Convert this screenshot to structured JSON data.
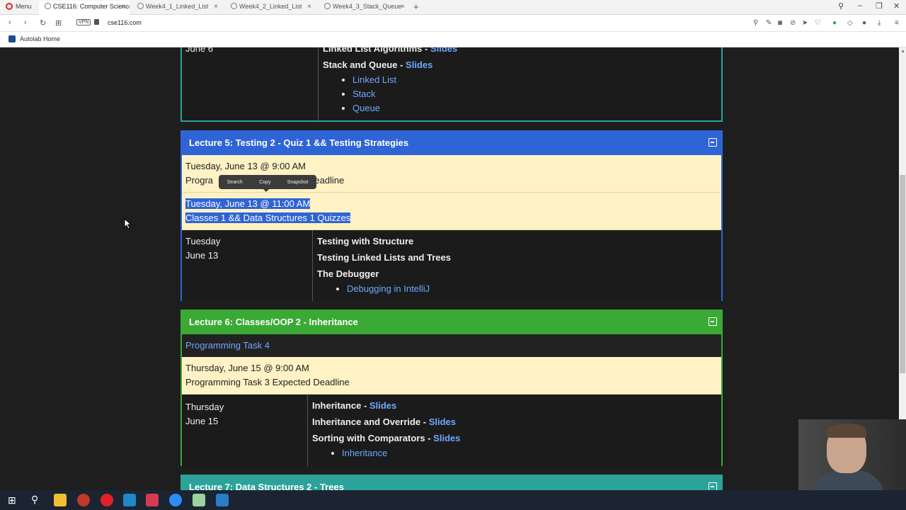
{
  "browser": {
    "menu_label": "Menu",
    "tabs": [
      {
        "title": "CSE116: Computer Science"
      },
      {
        "title": "Week4_1_Linked_List"
      },
      {
        "title": "Week4_2_Linked_List"
      },
      {
        "title": "Week4_3_Stack_Queue"
      }
    ],
    "vpn_label": "VPN",
    "url": "cse116.com",
    "bookmark": "Autolab Home"
  },
  "lecture4": {
    "date_partial": "June 6",
    "topics": [
      {
        "title": "Linked List Algorithms - ",
        "link": "Slides"
      },
      {
        "title": "Stack and Queue - ",
        "link": "Slides"
      }
    ],
    "sublinks": [
      "Linked List",
      "Stack",
      "Queue"
    ]
  },
  "lecture5": {
    "title": "Lecture 5: Testing 2 - Quiz 1 && Testing Strategies",
    "color": "#2f64d6",
    "events": [
      {
        "time": "Tuesday, June 13 @ 9:00 AM",
        "desc_start": "Progra",
        "desc_end": "Deadline"
      },
      {
        "time": "Tuesday, June 13 @ 11:00 AM",
        "desc": "Classes 1 && Data Structures 1 Quizzes"
      }
    ],
    "day": "Tuesday",
    "date": "June 13",
    "topics": [
      "Testing with Structure",
      "Testing Linked Lists and Trees",
      "The Debugger"
    ],
    "sublinks": [
      "Debugging in IntelliJ"
    ]
  },
  "popup": {
    "search": "Search",
    "copy": "Copy",
    "snapshot": "Snapshot"
  },
  "lecture6": {
    "title": "Lecture 6: Classes/OOP 2 - Inheritance",
    "color": "#3aaa35",
    "task_link": "Programming Task 4",
    "event_time": "Thursday, June 15 @ 9:00 AM",
    "event_desc": "Programming Task 3 Expected Deadline",
    "day": "Thursday",
    "date": "June 15",
    "topics": [
      {
        "title": "Inheritance - ",
        "link": "Slides"
      },
      {
        "title": "Inheritance and Override - ",
        "link": "Slides"
      },
      {
        "title": "Sorting with Comparators - ",
        "link": "Slides"
      }
    ],
    "sublinks": [
      "Inheritance"
    ]
  },
  "lecture7": {
    "title": "Lecture 7: Data Structures 2 - Trees",
    "color": "#2ba39a"
  }
}
